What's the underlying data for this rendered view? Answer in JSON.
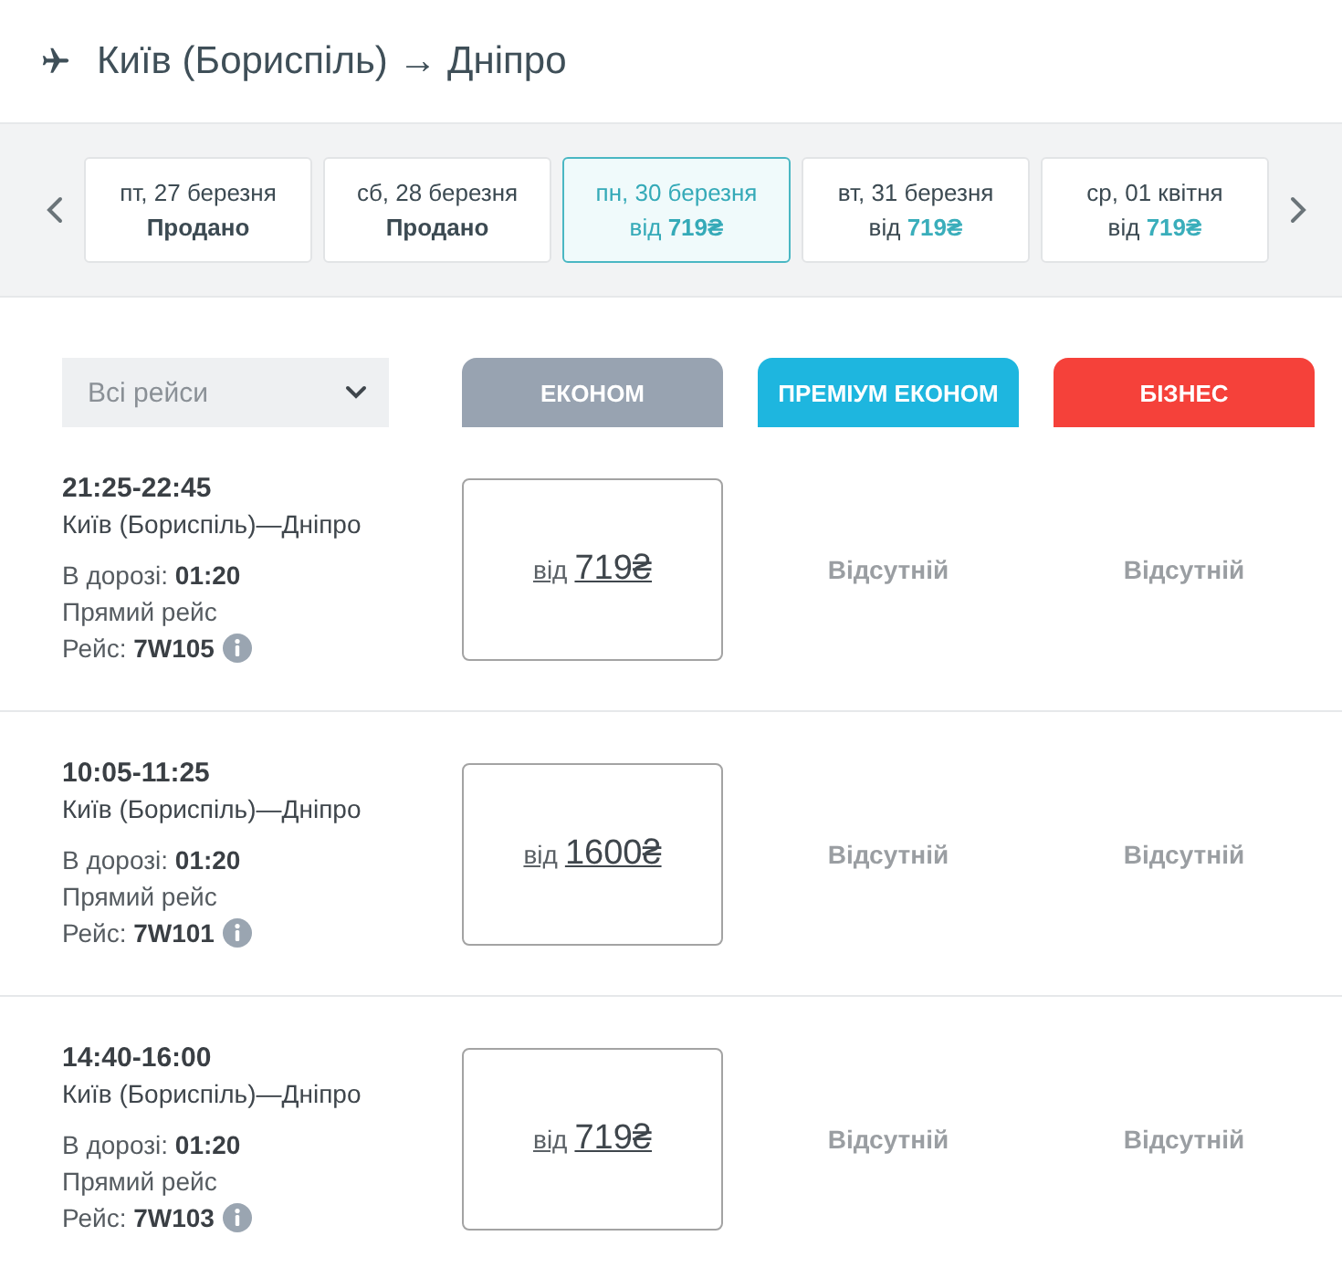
{
  "title": "Київ (Бориспіль) → Дніпро",
  "dates": [
    {
      "label": "пт, 27 березня",
      "status": "Продано",
      "kind": "sold",
      "selected": false
    },
    {
      "label": "сб, 28 березня",
      "status": "Продано",
      "kind": "sold",
      "selected": false
    },
    {
      "label": "пн, 30 березня",
      "prefix": "від",
      "price": "719₴",
      "kind": "price",
      "selected": true
    },
    {
      "label": "вт, 31 березня",
      "prefix": "від",
      "price": "719₴",
      "kind": "price",
      "selected": false
    },
    {
      "label": "ср, 01 квітня",
      "prefix": "від",
      "price": "719₴",
      "kind": "price",
      "selected": false
    }
  ],
  "filter": {
    "value": "Всі рейси"
  },
  "fare_classes": [
    {
      "label": "ЕКОНОМ",
      "color": "#98a3b1"
    },
    {
      "label": "ПРЕМІУМ ЕКОНОМ",
      "color": "#1eb6df"
    },
    {
      "label": "БІЗНЕС",
      "color": "#f5413a"
    }
  ],
  "flights": [
    {
      "time": "21:25-22:45",
      "route": "Київ (Бориспіль)—Дніпро",
      "duration": "В дорозі: **01:20**",
      "type": "Прямий рейс",
      "flight": "Рейс: **7W105**",
      "fares": [
        {
          "kind": "price",
          "prefix": "від",
          "price": "719₴"
        },
        {
          "kind": "unavailable",
          "text": "Відсутній"
        },
        {
          "kind": "unavailable",
          "text": "Відсутній"
        }
      ]
    },
    {
      "time": "10:05-11:25",
      "route": "Київ (Бориспіль)—Дніпро",
      "duration": "В дорозі: **01:20**",
      "type": "Прямий рейс",
      "flight": "Рейс: **7W101**",
      "fares": [
        {
          "kind": "price",
          "prefix": "від",
          "price": "1600₴"
        },
        {
          "kind": "unavailable",
          "text": "Відсутній"
        },
        {
          "kind": "unavailable",
          "text": "Відсутній"
        }
      ]
    },
    {
      "time": "14:40-16:00",
      "route": "Київ (Бориспіль)—Дніпро",
      "duration": "В дорозі: **01:20**",
      "type": "Прямий рейс",
      "flight": "Рейс: **7W103**",
      "fares": [
        {
          "kind": "price",
          "prefix": "від",
          "price": "719₴"
        },
        {
          "kind": "unavailable",
          "text": "Відсутній"
        },
        {
          "kind": "unavailable",
          "text": "Відсутній"
        }
      ]
    }
  ]
}
